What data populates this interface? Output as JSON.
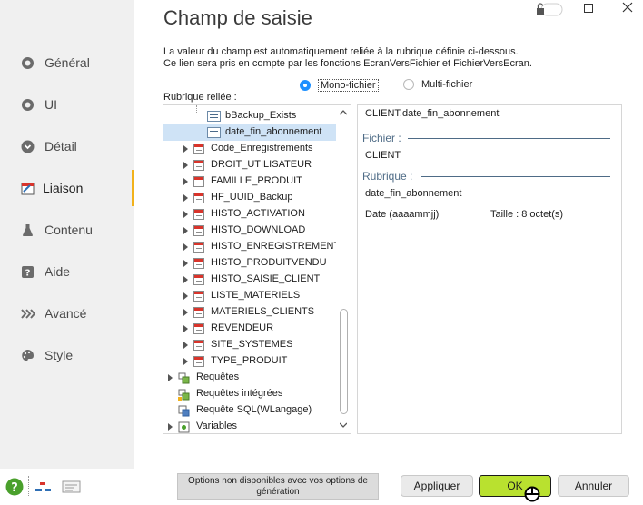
{
  "sidebar": {
    "items": [
      {
        "label": "Général",
        "icon": "circle-icon"
      },
      {
        "label": "UI",
        "icon": "circle-icon"
      },
      {
        "label": "Détail",
        "icon": "circle-chevron-icon"
      },
      {
        "label": "Liaison",
        "icon": "link-icon",
        "active": true
      },
      {
        "label": "Contenu",
        "icon": "flask-icon"
      },
      {
        "label": "Aide",
        "icon": "question-box-icon"
      },
      {
        "label": "Avancé",
        "icon": "chevrons-right-icon"
      },
      {
        "label": "Style",
        "icon": "palette-icon"
      }
    ]
  },
  "header": {
    "title": "Champ de saisie",
    "description_line1": "La valeur du champ est automatiquement reliée à la rubrique définie ci-dessous.",
    "description_line2": "Ce lien sera pris en compte par les fonctions EcranVersFichier et FichierVersEcran."
  },
  "mode": {
    "mono_label": "Mono-fichier",
    "multi_label": "Multi-fichier",
    "selected": "Mono-fichier"
  },
  "tree": {
    "label": "Rubrique reliée :",
    "rows": [
      {
        "text": "bBackup_Exists",
        "type": "field"
      },
      {
        "text": "date_fin_abonnement",
        "type": "field",
        "selected": true
      },
      {
        "text": "Code_Enregistrements",
        "type": "table"
      },
      {
        "text": "DROIT_UTILISATEUR",
        "type": "table"
      },
      {
        "text": "FAMILLE_PRODUIT",
        "type": "table"
      },
      {
        "text": "HF_UUID_Backup",
        "type": "table"
      },
      {
        "text": "HISTO_ACTIVATION",
        "type": "table"
      },
      {
        "text": "HISTO_DOWNLOAD",
        "type": "table"
      },
      {
        "text": "HISTO_ENREGISTREMENT",
        "type": "table"
      },
      {
        "text": "HISTO_PRODUITVENDU",
        "type": "table"
      },
      {
        "text": "HISTO_SAISIE_CLIENT",
        "type": "table"
      },
      {
        "text": "LISTE_MATERIELS",
        "type": "table"
      },
      {
        "text": "MATERIELS_CLIENTS",
        "type": "table"
      },
      {
        "text": "REVENDEUR",
        "type": "table"
      },
      {
        "text": "SITE_SYSTEMES",
        "type": "table"
      },
      {
        "text": "TYPE_PRODUIT",
        "type": "table"
      },
      {
        "text": "Requêtes",
        "type": "query"
      },
      {
        "text": "Requêtes intégrées",
        "type": "query"
      },
      {
        "text": "Requête SQL(WLangage)",
        "type": "sql"
      },
      {
        "text": "Variables",
        "type": "var"
      }
    ]
  },
  "detail": {
    "full_name": "CLIENT.date_fin_abonnement",
    "fichier_label": "Fichier :",
    "fichier_value": "CLIENT",
    "rubrique_label": "Rubrique :",
    "rubrique_value": "date_fin_abonnement",
    "type_value": "Date (aaaammjj)",
    "size_value": "Taille : 8 octet(s)"
  },
  "footer": {
    "note": "Options non disponibles avec vos options de génération",
    "apply_label": "Appliquer",
    "ok_label": "OK",
    "cancel_label": "Annuler"
  },
  "colors": {
    "accent": "#f2b21b",
    "ok_button": "#b9e12f",
    "radio_on": "#1e90ff",
    "help": "#4aa02c"
  }
}
